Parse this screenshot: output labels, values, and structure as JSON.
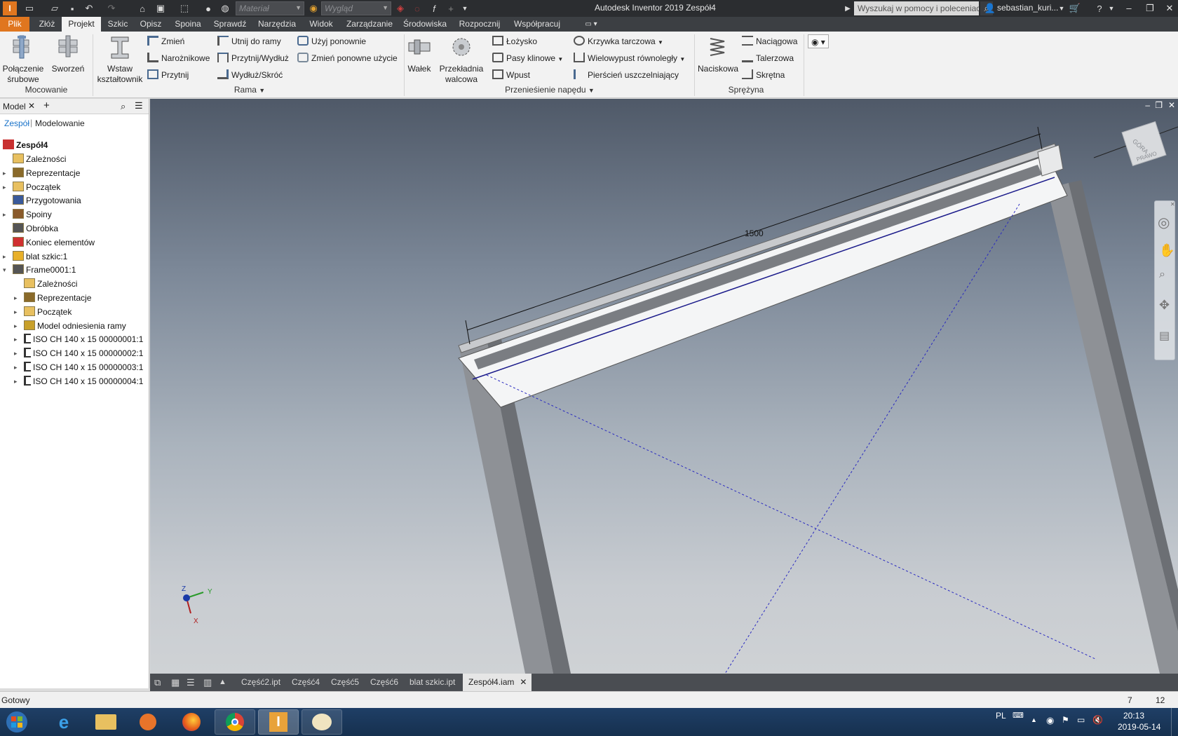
{
  "app": {
    "title": "Autodesk Inventor 2019   Zespół4",
    "help_search_placeholder": "Wyszukaj w pomocy i poleceniach...",
    "user": "sebastian_kuri...",
    "material_placeholder": "Materiał",
    "appearance_placeholder": "Wygląd"
  },
  "menu": {
    "tabs": [
      "Plik",
      "Złóż",
      "Projekt",
      "Szkic",
      "Opisz",
      "Spoina",
      "Sprawdź",
      "Narzędzia",
      "Widok",
      "Zarządzanie",
      "Środowiska",
      "Rozpocznij",
      "Współpracuj"
    ],
    "active": "Projekt"
  },
  "ribbon": {
    "mocowanie": {
      "label": "Mocowanie",
      "bolt": "Połączenie\nśrubowe",
      "pin": "Sworzeń"
    },
    "rama": {
      "label": "Rama",
      "insert": "Wstaw\nkształtownik",
      "change": "Zmień",
      "corner": "Narożnikowe",
      "trim": "Przytnij",
      "trim_to_frame": "Utnij do ramy",
      "trim_extend": "Przytnij/Wydłuż",
      "lengthen": "Wydłuż/Skróć",
      "reuse": "Użyj ponownie",
      "change_reuse": "Zmień ponowne użycie"
    },
    "naped": {
      "label": "Przenieśienie napędu",
      "shaft": "Wałek",
      "gear": "Przekładnia\nwalcowa",
      "bearing": "Łożysko",
      "vbelt": "Pasy klinowe",
      "key": "Wpust",
      "cam": "Krzywka tarczowa",
      "spline": "Wielowypust równoległy",
      "seal": "Pierścień uszczelniający"
    },
    "sprezyna": {
      "label": "Sprężyna",
      "compression": "Naciskowa",
      "extension": "Naciągowa",
      "belleville": "Talerzowa",
      "torsion": "Skrętna"
    }
  },
  "browser": {
    "tab": "Model",
    "sub_active": "Zespół",
    "sub_other": "Modelowanie",
    "root": "Zespół4",
    "items": [
      {
        "label": "Zależności",
        "level": 1,
        "exp": false
      },
      {
        "label": "Reprezentacje",
        "level": 1,
        "exp": true
      },
      {
        "label": "Początek",
        "level": 1,
        "exp": true
      },
      {
        "label": "Przygotowania",
        "level": 1,
        "exp": false
      },
      {
        "label": "Spoiny",
        "level": 1,
        "exp": true
      },
      {
        "label": "Obróbka",
        "level": 1,
        "exp": false
      },
      {
        "label": "Koniec elementów",
        "level": 1,
        "exp": false
      },
      {
        "label": "blat szkic:1",
        "level": 1,
        "exp": true
      },
      {
        "label": "Frame0001:1",
        "level": 1,
        "exp": true,
        "open": true
      },
      {
        "label": "Zależności",
        "level": 2,
        "exp": false
      },
      {
        "label": "Reprezentacje",
        "level": 2,
        "exp": true
      },
      {
        "label": "Początek",
        "level": 2,
        "exp": true
      },
      {
        "label": "Model odniesienia ramy",
        "level": 2,
        "exp": true
      },
      {
        "label": "ISO CH 140 x 15 00000001:1",
        "level": 2,
        "exp": true
      },
      {
        "label": "ISO CH 140 x 15 00000002:1",
        "level": 2,
        "exp": true
      },
      {
        "label": "ISO CH 140 x 15 00000003:1",
        "level": 2,
        "exp": true
      },
      {
        "label": "ISO CH 140 x 15 00000004:1",
        "level": 2,
        "exp": true
      }
    ]
  },
  "viewport": {
    "dimension": "1500",
    "viewcube_top": "GÓRA",
    "viewcube_side": "PRAWO",
    "axis_x": "X",
    "axis_y": "Y",
    "axis_z": "Z"
  },
  "doc_tabs": [
    "Część2.ipt",
    "Część4",
    "Część5",
    "Część6",
    "blat szkic.ipt",
    "Zespół4.iam"
  ],
  "active_doc": "Zespół4.iam",
  "status": {
    "text": "Gotowy",
    "n1": "7",
    "n2": "12"
  },
  "taskbar": {
    "lang": "PL",
    "time": "20:13",
    "date": "2019-05-14"
  }
}
